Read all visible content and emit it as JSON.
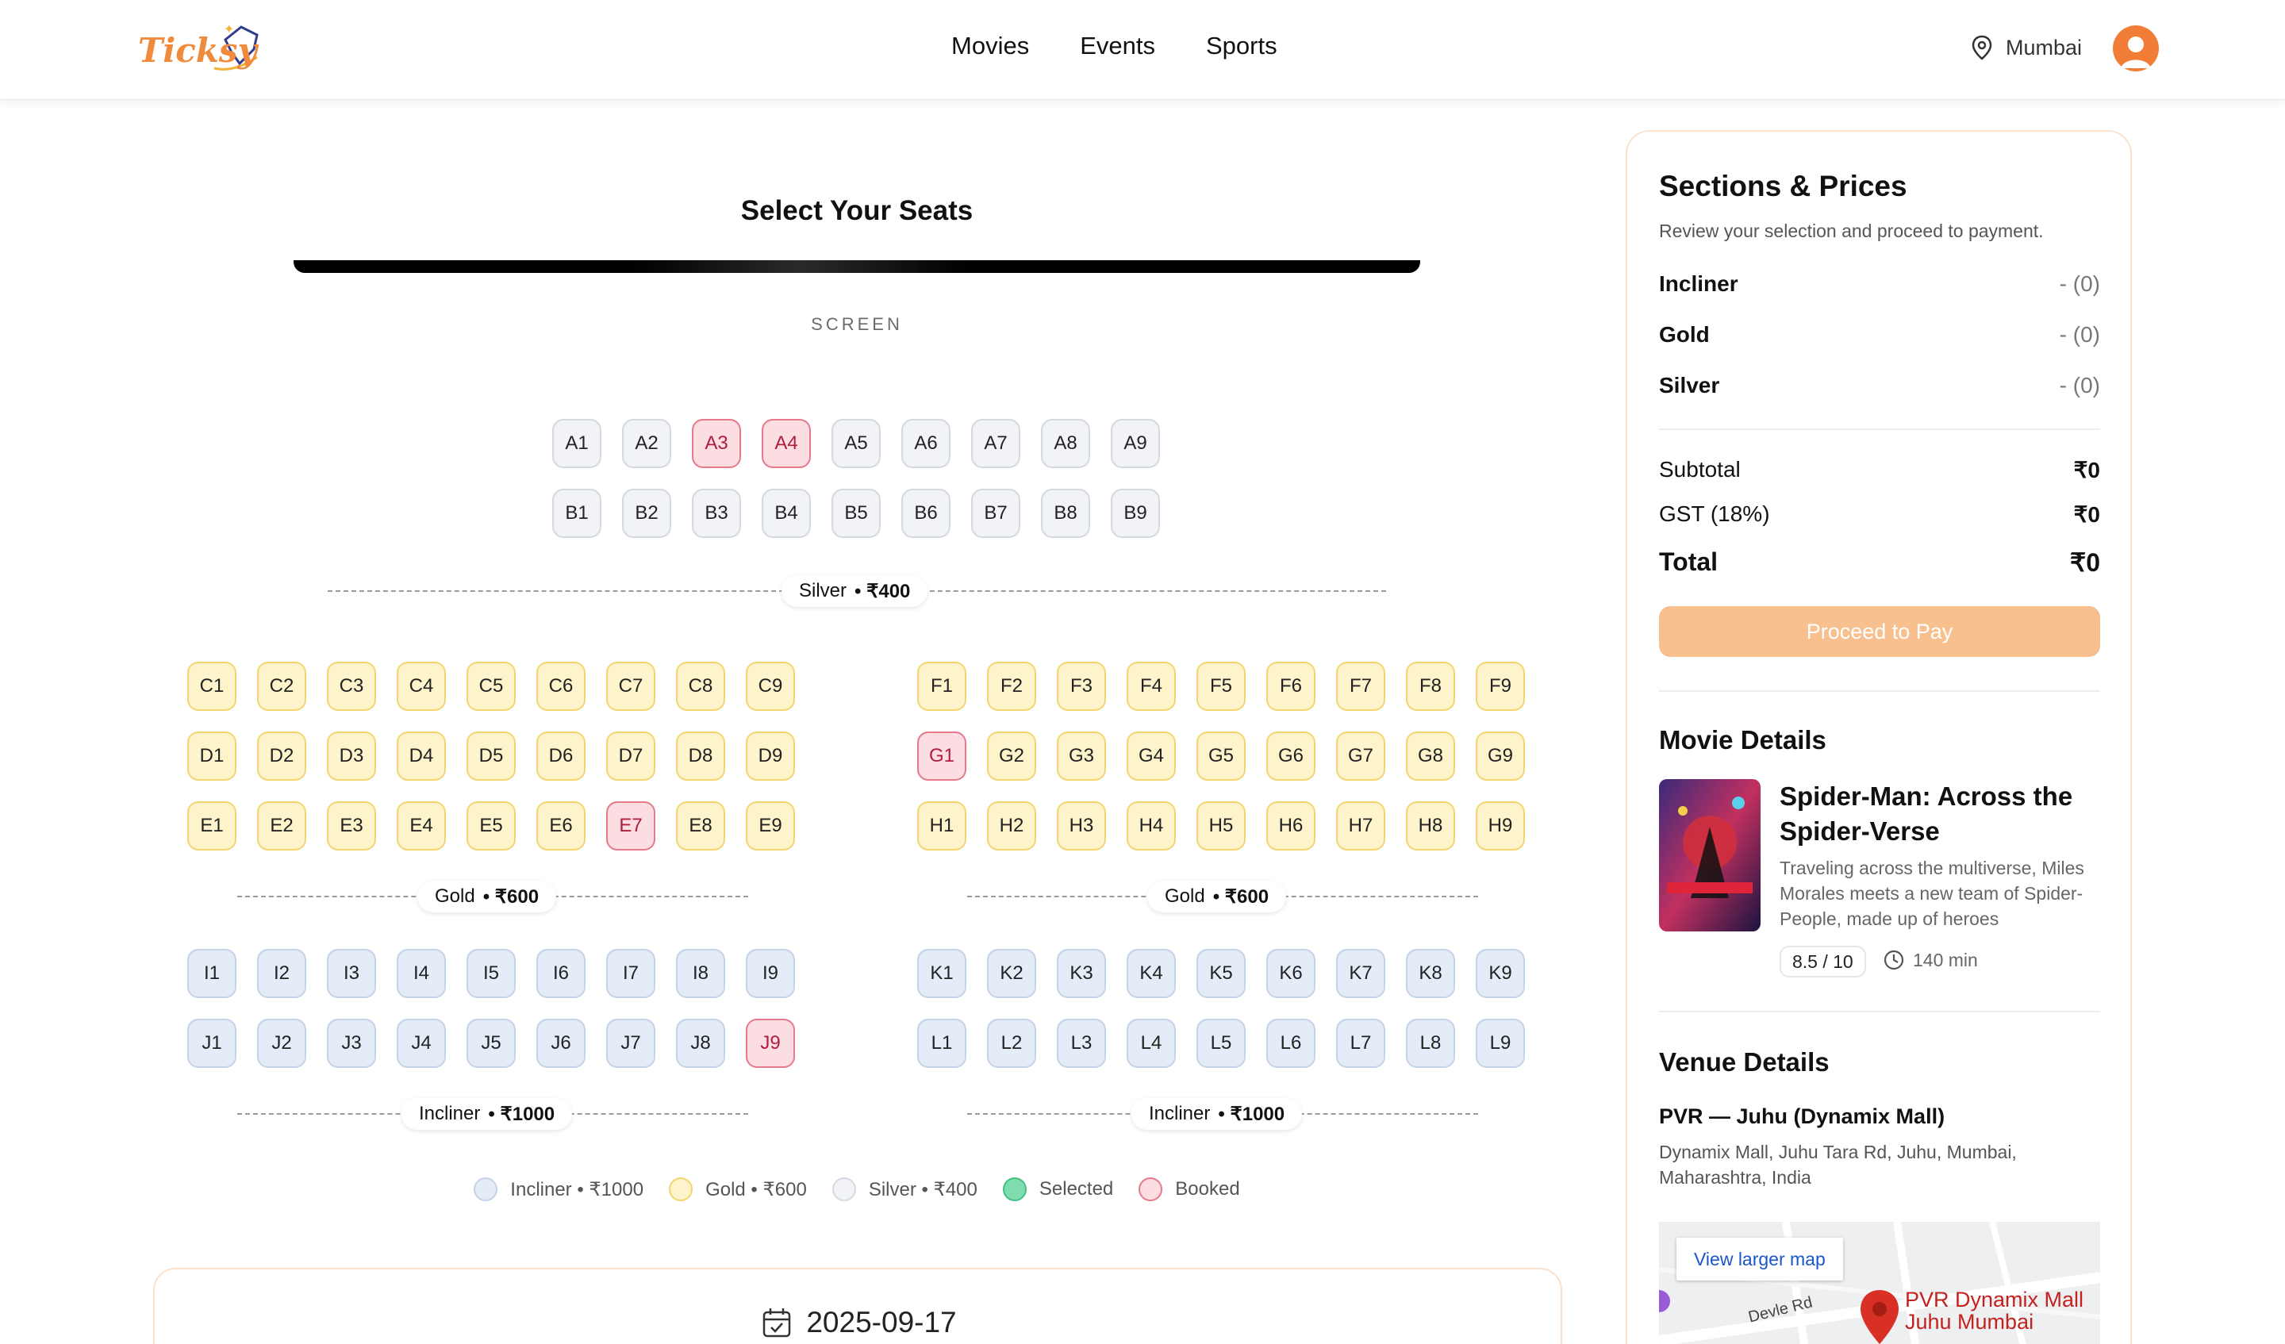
{
  "header": {
    "brand": "Ticksy",
    "nav": [
      "Movies",
      "Events",
      "Sports"
    ],
    "location": "Mumbai"
  },
  "seat_map": {
    "title": "Select Your Seats",
    "screen_label": "SCREEN",
    "silver_rows": [
      {
        "seats": [
          [
            "A1",
            "silver"
          ],
          [
            "A2",
            "silver"
          ],
          [
            "A3",
            "booked"
          ],
          [
            "A4",
            "booked"
          ],
          [
            "A5",
            "silver"
          ],
          [
            "A6",
            "silver"
          ],
          [
            "A7",
            "silver"
          ],
          [
            "A8",
            "silver"
          ],
          [
            "A9",
            "silver"
          ]
        ]
      },
      {
        "seats": [
          [
            "B1",
            "silver"
          ],
          [
            "B2",
            "silver"
          ],
          [
            "B3",
            "silver"
          ],
          [
            "B4",
            "silver"
          ],
          [
            "B5",
            "silver"
          ],
          [
            "B6",
            "silver"
          ],
          [
            "B7",
            "silver"
          ],
          [
            "B8",
            "silver"
          ],
          [
            "B9",
            "silver"
          ]
        ]
      }
    ],
    "gold_left_rows": [
      {
        "seats": [
          [
            "C1",
            "gold"
          ],
          [
            "C2",
            "gold"
          ],
          [
            "C3",
            "gold"
          ],
          [
            "C4",
            "gold"
          ],
          [
            "C5",
            "gold"
          ],
          [
            "C6",
            "gold"
          ],
          [
            "C7",
            "gold"
          ],
          [
            "C8",
            "gold"
          ],
          [
            "C9",
            "gold"
          ]
        ]
      },
      {
        "seats": [
          [
            "D1",
            "gold"
          ],
          [
            "D2",
            "gold"
          ],
          [
            "D3",
            "gold"
          ],
          [
            "D4",
            "gold"
          ],
          [
            "D5",
            "gold"
          ],
          [
            "D6",
            "gold"
          ],
          [
            "D7",
            "gold"
          ],
          [
            "D8",
            "gold"
          ],
          [
            "D9",
            "gold"
          ]
        ]
      },
      {
        "seats": [
          [
            "E1",
            "gold"
          ],
          [
            "E2",
            "gold"
          ],
          [
            "E3",
            "gold"
          ],
          [
            "E4",
            "gold"
          ],
          [
            "E5",
            "gold"
          ],
          [
            "E6",
            "gold"
          ],
          [
            "E7",
            "booked"
          ],
          [
            "E8",
            "gold"
          ],
          [
            "E9",
            "gold"
          ]
        ]
      }
    ],
    "gold_right_rows": [
      {
        "seats": [
          [
            "F1",
            "gold"
          ],
          [
            "F2",
            "gold"
          ],
          [
            "F3",
            "gold"
          ],
          [
            "F4",
            "gold"
          ],
          [
            "F5",
            "gold"
          ],
          [
            "F6",
            "gold"
          ],
          [
            "F7",
            "gold"
          ],
          [
            "F8",
            "gold"
          ],
          [
            "F9",
            "gold"
          ]
        ]
      },
      {
        "seats": [
          [
            "G1",
            "booked"
          ],
          [
            "G2",
            "gold"
          ],
          [
            "G3",
            "gold"
          ],
          [
            "G4",
            "gold"
          ],
          [
            "G5",
            "gold"
          ],
          [
            "G6",
            "gold"
          ],
          [
            "G7",
            "gold"
          ],
          [
            "G8",
            "gold"
          ],
          [
            "G9",
            "gold"
          ]
        ]
      },
      {
        "seats": [
          [
            "H1",
            "gold"
          ],
          [
            "H2",
            "gold"
          ],
          [
            "H3",
            "gold"
          ],
          [
            "H4",
            "gold"
          ],
          [
            "H5",
            "gold"
          ],
          [
            "H6",
            "gold"
          ],
          [
            "H7",
            "gold"
          ],
          [
            "H8",
            "gold"
          ],
          [
            "H9",
            "gold"
          ]
        ]
      }
    ],
    "incliner_left_rows": [
      {
        "seats": [
          [
            "I1",
            "incliner"
          ],
          [
            "I2",
            "incliner"
          ],
          [
            "I3",
            "incliner"
          ],
          [
            "I4",
            "incliner"
          ],
          [
            "I5",
            "incliner"
          ],
          [
            "I6",
            "incliner"
          ],
          [
            "I7",
            "incliner"
          ],
          [
            "I8",
            "incliner"
          ],
          [
            "I9",
            "incliner"
          ]
        ]
      },
      {
        "seats": [
          [
            "J1",
            "incliner"
          ],
          [
            "J2",
            "incliner"
          ],
          [
            "J3",
            "incliner"
          ],
          [
            "J4",
            "incliner"
          ],
          [
            "J5",
            "incliner"
          ],
          [
            "J6",
            "incliner"
          ],
          [
            "J7",
            "incliner"
          ],
          [
            "J8",
            "incliner"
          ],
          [
            "J9",
            "booked"
          ]
        ]
      }
    ],
    "incliner_right_rows": [
      {
        "seats": [
          [
            "K1",
            "incliner"
          ],
          [
            "K2",
            "incliner"
          ],
          [
            "K3",
            "incliner"
          ],
          [
            "K4",
            "incliner"
          ],
          [
            "K5",
            "incliner"
          ],
          [
            "K6",
            "incliner"
          ],
          [
            "K7",
            "incliner"
          ],
          [
            "K8",
            "incliner"
          ],
          [
            "K9",
            "incliner"
          ]
        ]
      },
      {
        "seats": [
          [
            "L1",
            "incliner"
          ],
          [
            "L2",
            "incliner"
          ],
          [
            "L3",
            "incliner"
          ],
          [
            "L4",
            "incliner"
          ],
          [
            "L5",
            "incliner"
          ],
          [
            "L6",
            "incliner"
          ],
          [
            "L7",
            "incliner"
          ],
          [
            "L8",
            "incliner"
          ],
          [
            "L9",
            "incliner"
          ]
        ]
      }
    ],
    "section_labels": {
      "silver": {
        "name": "Silver",
        "price": "• ₹400"
      },
      "gold": {
        "name": "Gold",
        "price": "• ₹600"
      },
      "incliner": {
        "name": "Incliner",
        "price": "• ₹1000"
      }
    },
    "legend": [
      {
        "label": "Incliner • ₹1000",
        "fill": "#e3ecf7",
        "border": "#c3d3e8"
      },
      {
        "label": "Gold • ₹600",
        "fill": "#fdf4cc",
        "border": "#f2d56f"
      },
      {
        "label": "Silver • ₹400",
        "fill": "#f1f3f6",
        "border": "#d5dae2"
      },
      {
        "label": "Selected",
        "fill": "#7fdcae",
        "border": "#43c184"
      },
      {
        "label": "Booked",
        "fill": "#fbdde2",
        "border": "#e67a8d"
      }
    ]
  },
  "date": "2025-09-17",
  "summary": {
    "title": "Sections & Prices",
    "subtitle": "Review your selection and proceed to payment.",
    "sections": [
      {
        "name": "Incliner",
        "value": "- (0)"
      },
      {
        "name": "Gold",
        "value": "- (0)"
      },
      {
        "name": "Silver",
        "value": "- (0)"
      }
    ],
    "subtotal_label": "Subtotal",
    "subtotal_value": "₹0",
    "gst_label": "GST (18%)",
    "gst_value": "₹0",
    "total_label": "Total",
    "total_value": "₹0",
    "pay_label": "Proceed to Pay"
  },
  "movie": {
    "heading": "Movie Details",
    "title": "Spider-Man: Across the Spider-Verse",
    "description": "Traveling across the multiverse, Miles Morales meets a new team of Spider-People, made up of heroes",
    "rating": "8.5 / 10",
    "duration": "140 min"
  },
  "venue": {
    "heading": "Venue Details",
    "name": "PVR — Juhu (Dynamix Mall)",
    "address": "Dynamix Mall, Juhu Tara Rd, Juhu, Mumbai, Maharashtra, India",
    "map_button": "View larger map",
    "map_place": "PVR Dynamix Mall Juhu Mumbai",
    "map_road": "Devle Rd"
  },
  "colors": {
    "brand": "#f08a3c",
    "pay_button": "#f8c08f",
    "booked": "#e67a8d"
  }
}
